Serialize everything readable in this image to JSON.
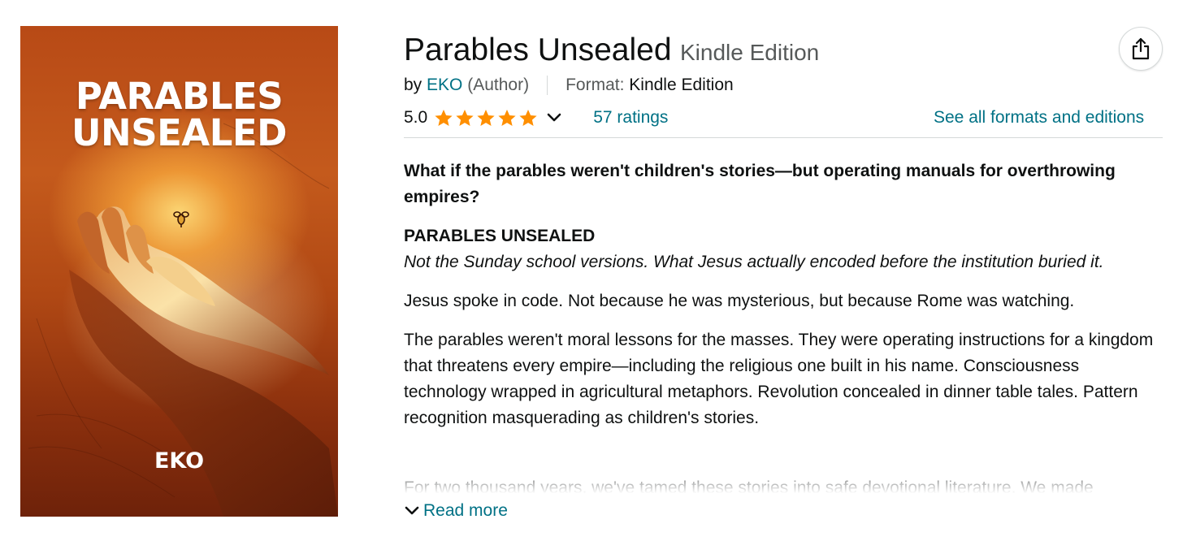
{
  "cover": {
    "title_line1": "PARABLES",
    "title_line2": "UNSEALED",
    "author": "EKO",
    "colors": {
      "background": "#b84a16",
      "glow": "#ffd878",
      "text": "#ffffff"
    }
  },
  "share": {
    "icon": "share-icon"
  },
  "product": {
    "title": "Parables Unsealed",
    "edition": "Kindle Edition",
    "by_prefix": "by",
    "author": "EKO",
    "author_role": "(Author)",
    "format_label": "Format:",
    "format_value": "Kindle Edition"
  },
  "rating": {
    "score": "5.0",
    "stars": 5,
    "ratings_count": "57 ratings",
    "see_all_formats": "See all formats and editions",
    "star_color": "#ff8f00"
  },
  "description": {
    "hook": "What if the parables weren't children's stories—but operating manuals for overthrowing empires?",
    "heading": "PARABLES UNSEALED",
    "subheading": "Not the Sunday school versions. What Jesus actually encoded before the institution buried it.",
    "para1": "Jesus spoke in code. Not because he was mysterious, but because Rome was watching.",
    "para2": "The parables weren't moral lessons for the masses. They were operating instructions for a kingdom that threatens every empire—including the religious one built in his name. Consciousness technology wrapped in agricultural metaphors. Revolution concealed in dinner table tales. Pattern recognition masquerading as children's stories.",
    "para3_fade": "For two thousand years, we've tamed these stories into safe devotional literature. We made",
    "read_more": "Read more"
  },
  "colors": {
    "link": "#007185",
    "text": "#0f1111",
    "muted": "#565959",
    "divider": "#d5d9d9"
  }
}
